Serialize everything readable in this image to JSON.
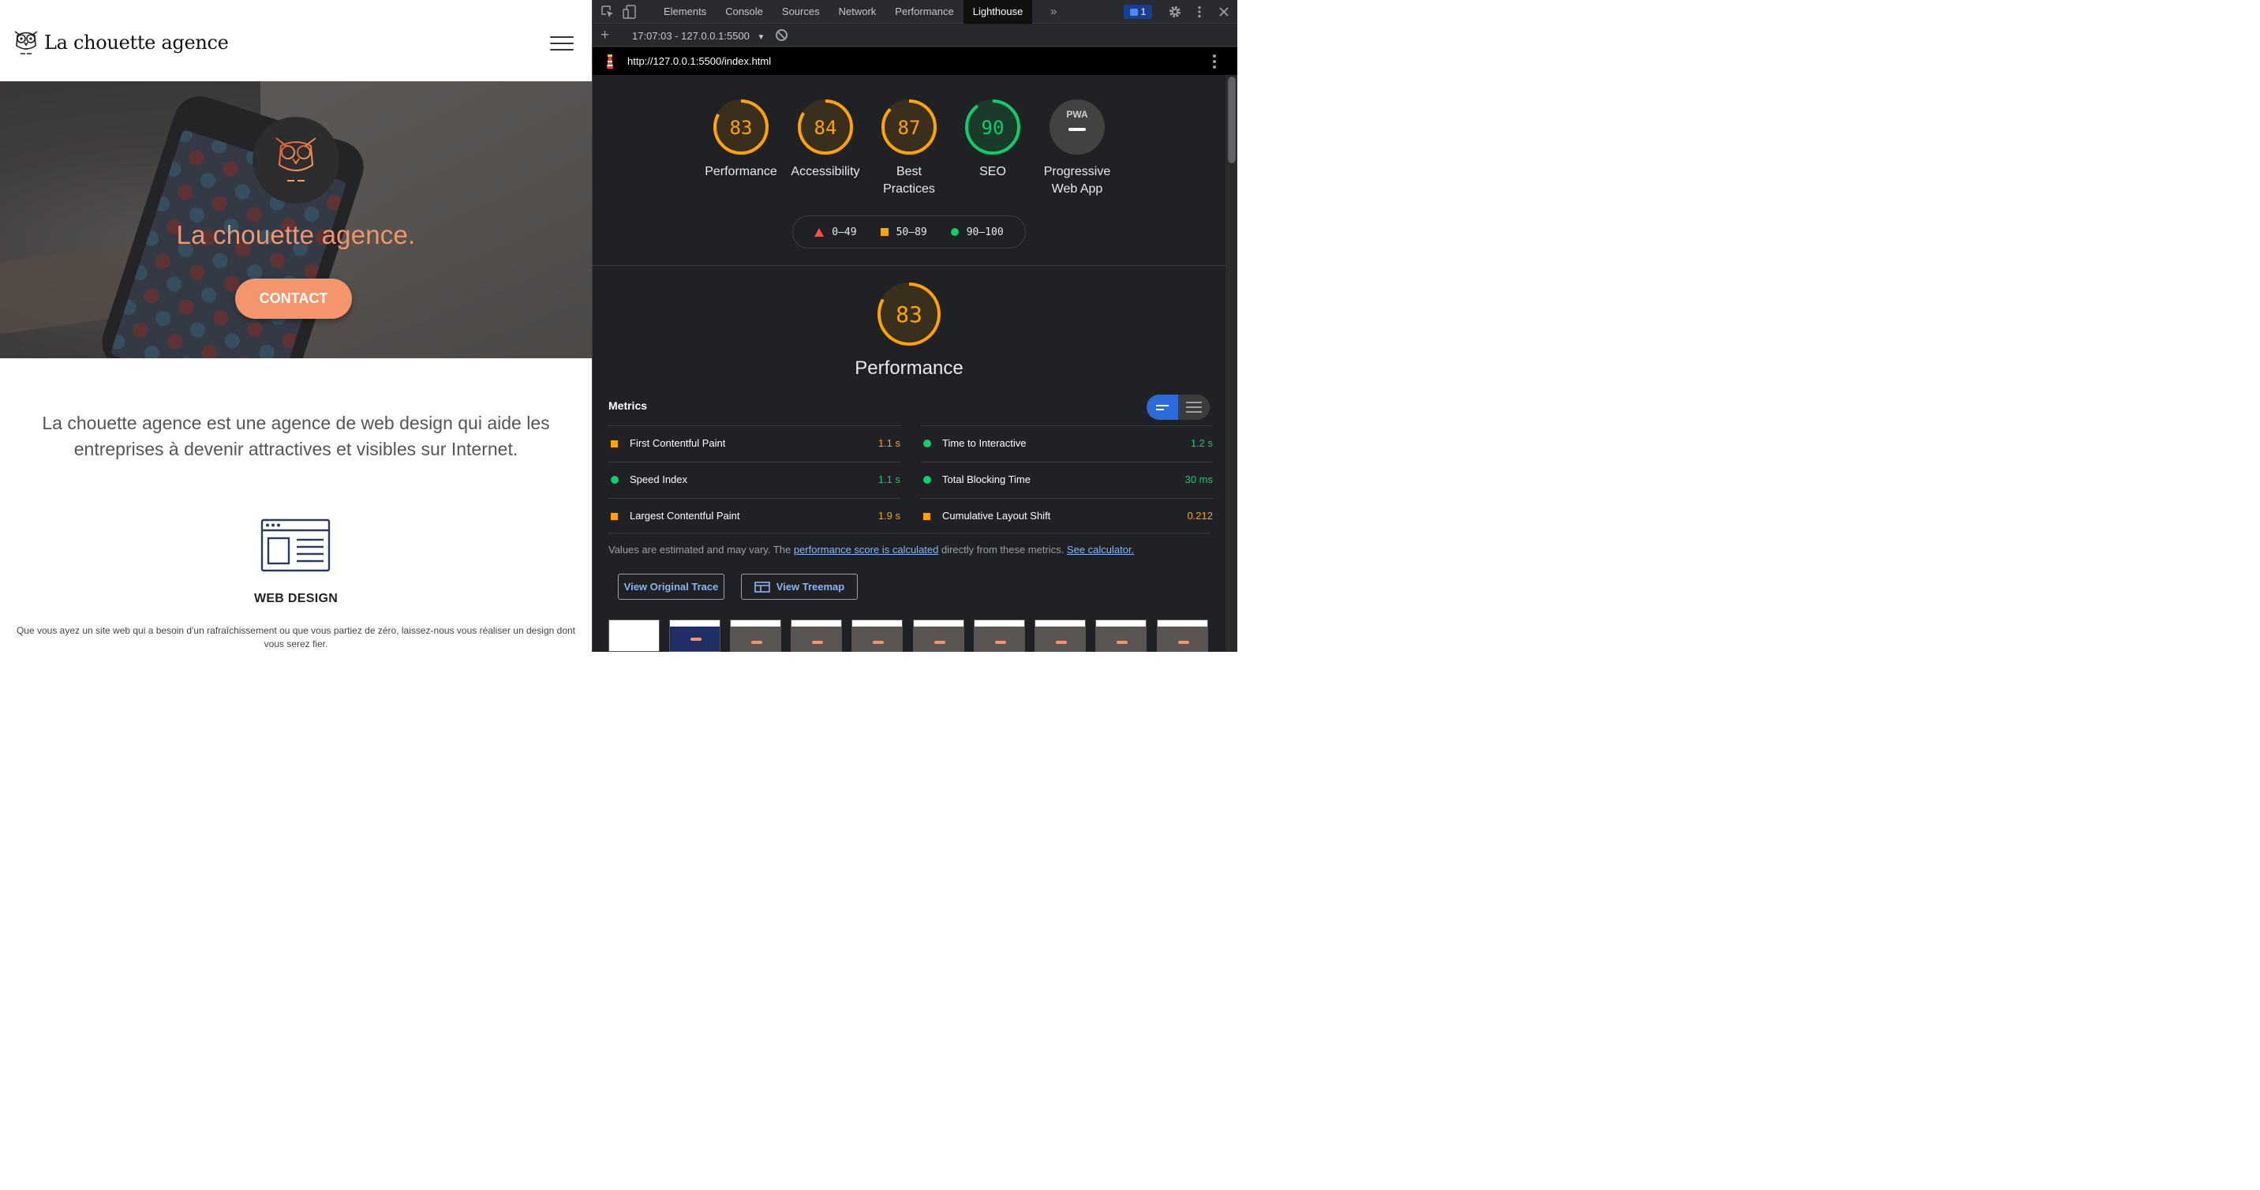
{
  "site": {
    "logo_text": "La chouette agence",
    "hero_title": "La chouette agence.",
    "contact_label": "CONTACT",
    "intro": "La chouette agence est une agence de web design qui aide les entreprises à devenir attractives et visibles sur Internet.",
    "service_title": "WEB DESIGN",
    "service_text": "Que vous ayez un site web qui a besoin d'un rafraîchissement ou que vous partiez de zéro, laissez-nous vous réaliser un design dont vous serez fier.",
    "accent_color": "#f4956b"
  },
  "devtools": {
    "tabs": [
      "Elements",
      "Console",
      "Sources",
      "Network",
      "Performance",
      "Lighthouse"
    ],
    "active_tab": "Lighthouse",
    "issues_count": "1",
    "report_selector": "17:07:03 - 127.0.0.1:5500",
    "report_url": "http://127.0.0.1:5500/index.html"
  },
  "lighthouse": {
    "categories": [
      {
        "label": "Performance",
        "score": 83,
        "color": "#ffa400"
      },
      {
        "label": "Accessibility",
        "score": 84,
        "color": "#ffa400"
      },
      {
        "label": "Best Practices",
        "score": 87,
        "color": "#ffa400"
      },
      {
        "label": "SEO",
        "score": 90,
        "color": "#0cce6b"
      },
      {
        "label": "Progressive Web App",
        "score": null,
        "badge": "PWA"
      }
    ],
    "legend": {
      "fail": "0–49",
      "average": "50–89",
      "pass": "90–100"
    },
    "perf_score": "83",
    "perf_title": "Performance",
    "metrics_heading": "Metrics",
    "metrics": [
      {
        "name": "First Contentful Paint",
        "value": "1.1 s",
        "rating": "average"
      },
      {
        "name": "Time to Interactive",
        "value": "1.2 s",
        "rating": "pass"
      },
      {
        "name": "Speed Index",
        "value": "1.1 s",
        "rating": "pass"
      },
      {
        "name": "Total Blocking Time",
        "value": "30 ms",
        "rating": "pass"
      },
      {
        "name": "Largest Contentful Paint",
        "value": "1.9 s",
        "rating": "average"
      },
      {
        "name": "Cumulative Layout Shift",
        "value": "0.212",
        "rating": "average"
      }
    ],
    "note_prefix": "Values are estimated and may vary. The ",
    "note_link1": "performance score is calculated",
    "note_middle": " directly from these metrics. ",
    "note_link2": "See calculator.",
    "view_trace_label": "View Original Trace",
    "view_treemap_label": "View Treemap",
    "colors": {
      "fail": "#ff4e42",
      "average": "#ffa400",
      "pass": "#0cce6b"
    }
  }
}
